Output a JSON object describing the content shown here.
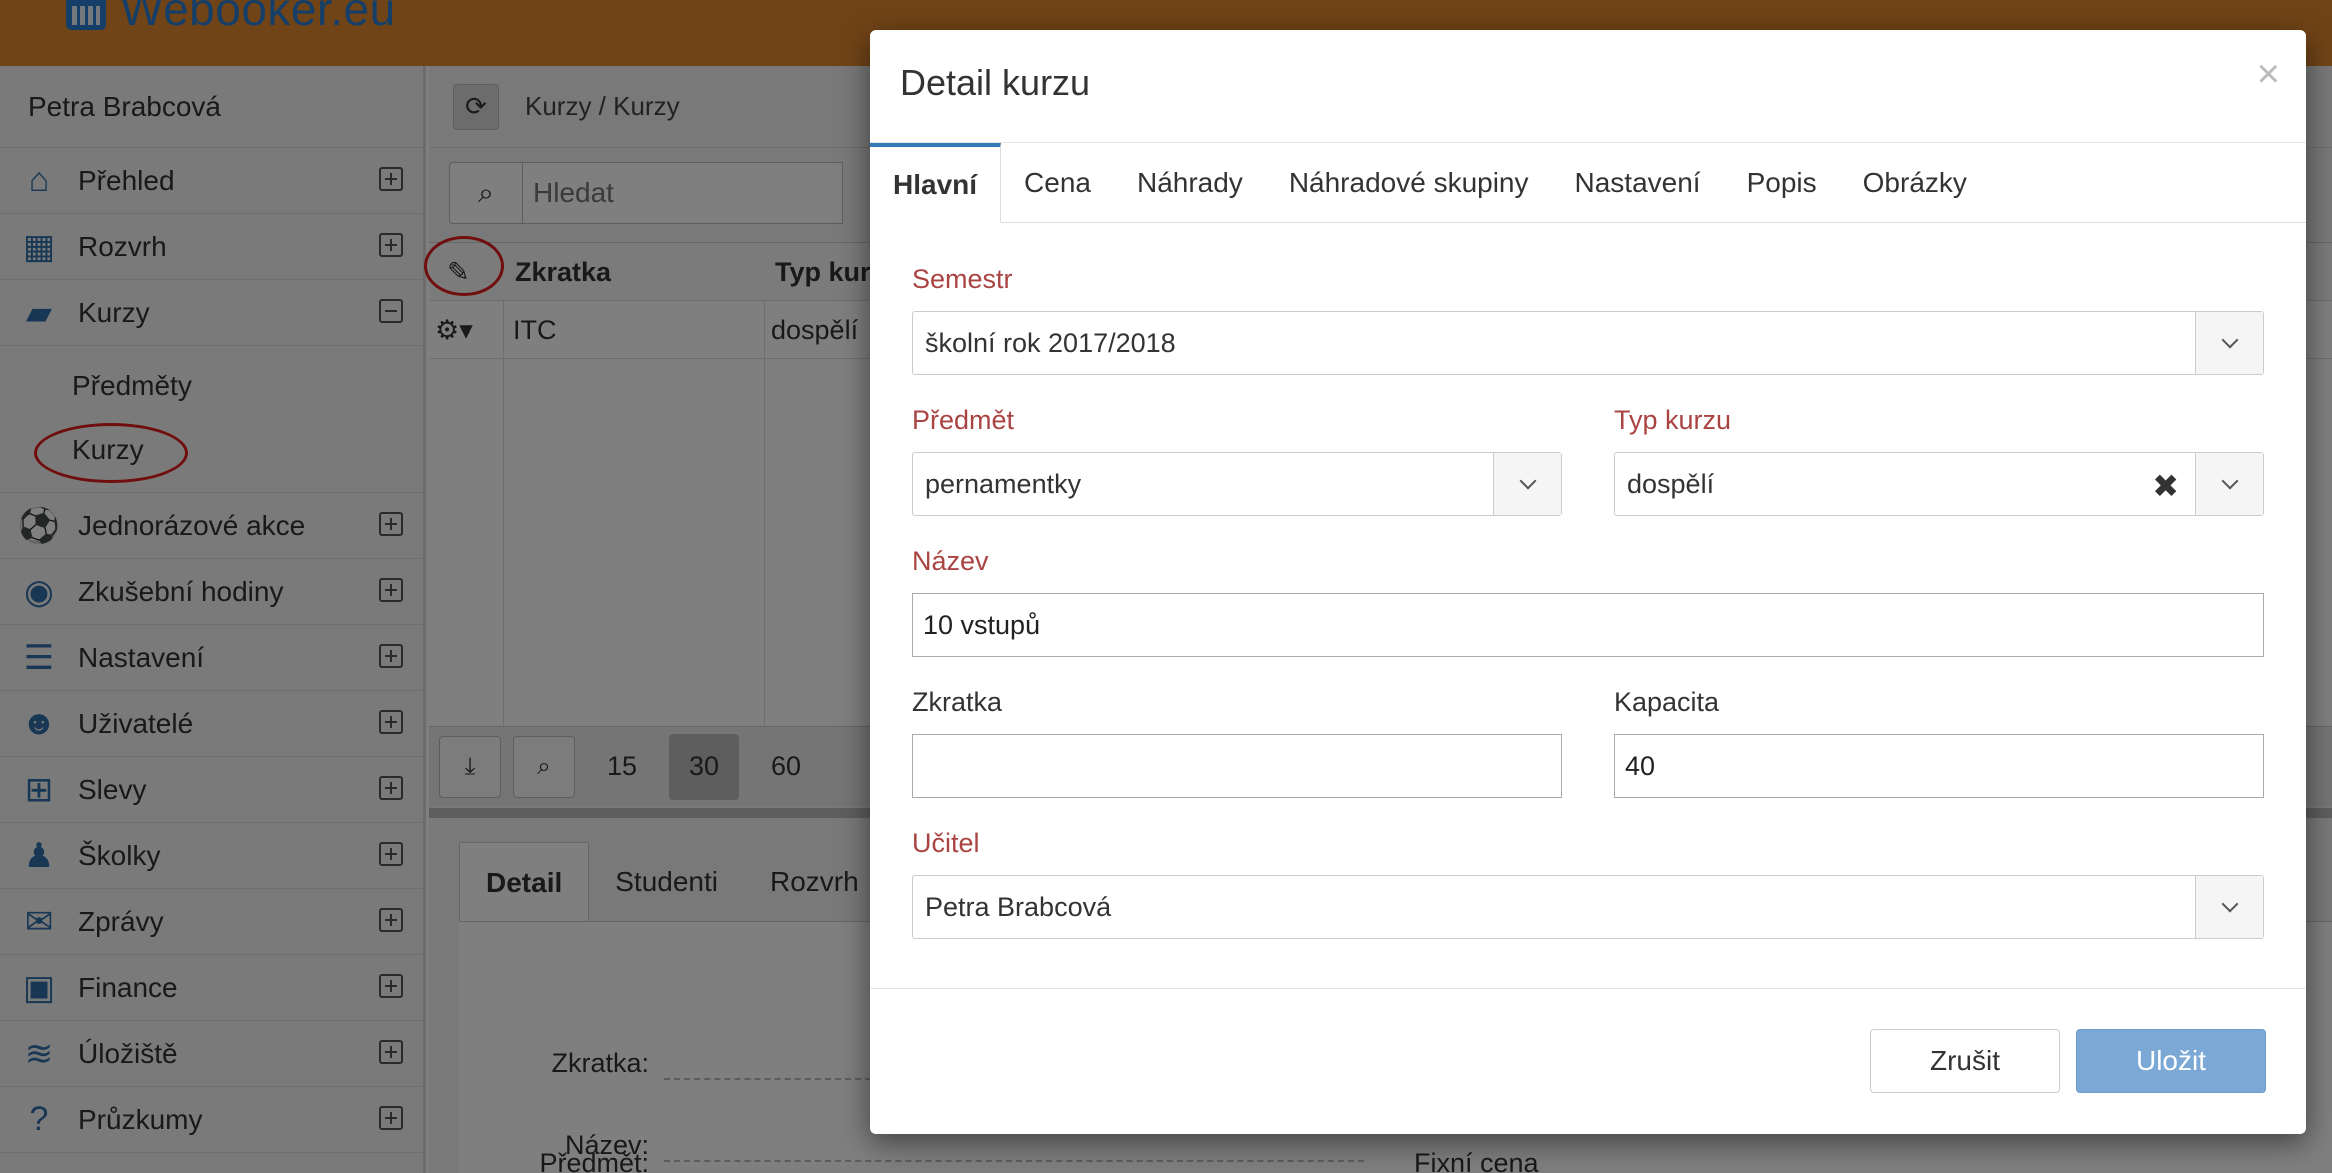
{
  "app": {
    "brand": "Webooker.eu"
  },
  "sidebar": {
    "user": "Petra Brabcová",
    "items": [
      {
        "label": "Přehled",
        "icon": "home-icon",
        "glyph": "⌂",
        "state": "plus"
      },
      {
        "label": "Rozvrh",
        "icon": "calendar-icon",
        "glyph": "▦",
        "state": "plus"
      },
      {
        "label": "Kurzy",
        "icon": "book-icon",
        "glyph": "▰",
        "state": "minus"
      },
      {
        "label": "Jednorázové akce",
        "icon": "soccer-ball-icon",
        "glyph": "⚽",
        "state": "plus"
      },
      {
        "label": "Zkušební hodiny",
        "icon": "eye-slash-icon",
        "glyph": "◉",
        "state": "plus"
      },
      {
        "label": "Nastavení",
        "icon": "server-icon",
        "glyph": "☰",
        "state": "plus"
      },
      {
        "label": "Uživatelé",
        "icon": "users-icon",
        "glyph": "☻",
        "state": "plus"
      },
      {
        "label": "Slevy",
        "icon": "gift-icon",
        "glyph": "⊞",
        "state": "plus"
      },
      {
        "label": "Školky",
        "icon": "child-icon",
        "glyph": "♟",
        "state": "plus"
      },
      {
        "label": "Zprávy",
        "icon": "envelope-icon",
        "glyph": "✉",
        "state": "plus"
      },
      {
        "label": "Finance",
        "icon": "money-icon",
        "glyph": "▣",
        "state": "plus"
      },
      {
        "label": "Úložiště",
        "icon": "database-icon",
        "glyph": "≋",
        "state": "plus"
      },
      {
        "label": "Průzkumy",
        "icon": "question-icon",
        "glyph": "?",
        "state": "plus"
      }
    ],
    "subitems": [
      "Předměty",
      "Kurzy"
    ]
  },
  "content": {
    "breadcrumb": "Kurzy / Kurzy",
    "search_placeholder": "Hledat",
    "grid": {
      "headers": [
        "Zkratka",
        "Typ kurz"
      ],
      "row": [
        "ITC",
        "dospělí"
      ]
    },
    "pager": {
      "sizes": [
        "15",
        "30",
        "60"
      ],
      "active": "30"
    },
    "detail_tabs": [
      "Detail",
      "Studenti",
      "Rozvrh"
    ],
    "detail_labels": [
      "Zkratka:",
      "Název:",
      "Předmět:",
      "Fixní cena kurzu:"
    ]
  },
  "modal": {
    "title": "Detail kurzu",
    "close": "×",
    "tabs": [
      "Hlavní",
      "Cena",
      "Náhrady",
      "Náhradové skupiny",
      "Nastavení",
      "Popis",
      "Obrázky"
    ],
    "fields": {
      "semestr": {
        "label": "Semestr",
        "value": "školní rok 2017/2018"
      },
      "predmet": {
        "label": "Předmět",
        "value": "pernamentky"
      },
      "typ_kurzu": {
        "label": "Typ kurzu",
        "value": "dospělí"
      },
      "nazev": {
        "label": "Název",
        "value": "10 vstupů"
      },
      "zkratka": {
        "label": "Zkratka",
        "value": ""
      },
      "kapacita": {
        "label": "Kapacita",
        "value": "40"
      },
      "ucitel": {
        "label": "Učitel",
        "value": "Petra Brabcová"
      }
    },
    "buttons": {
      "cancel": "Zrušit",
      "save": "Uložit"
    }
  },
  "colors": {
    "topbar": "#e2882e",
    "brand": "#2a7fd2",
    "required": "#a94442",
    "primary": "#7ca8d6",
    "annotation": "#e01b1b"
  }
}
